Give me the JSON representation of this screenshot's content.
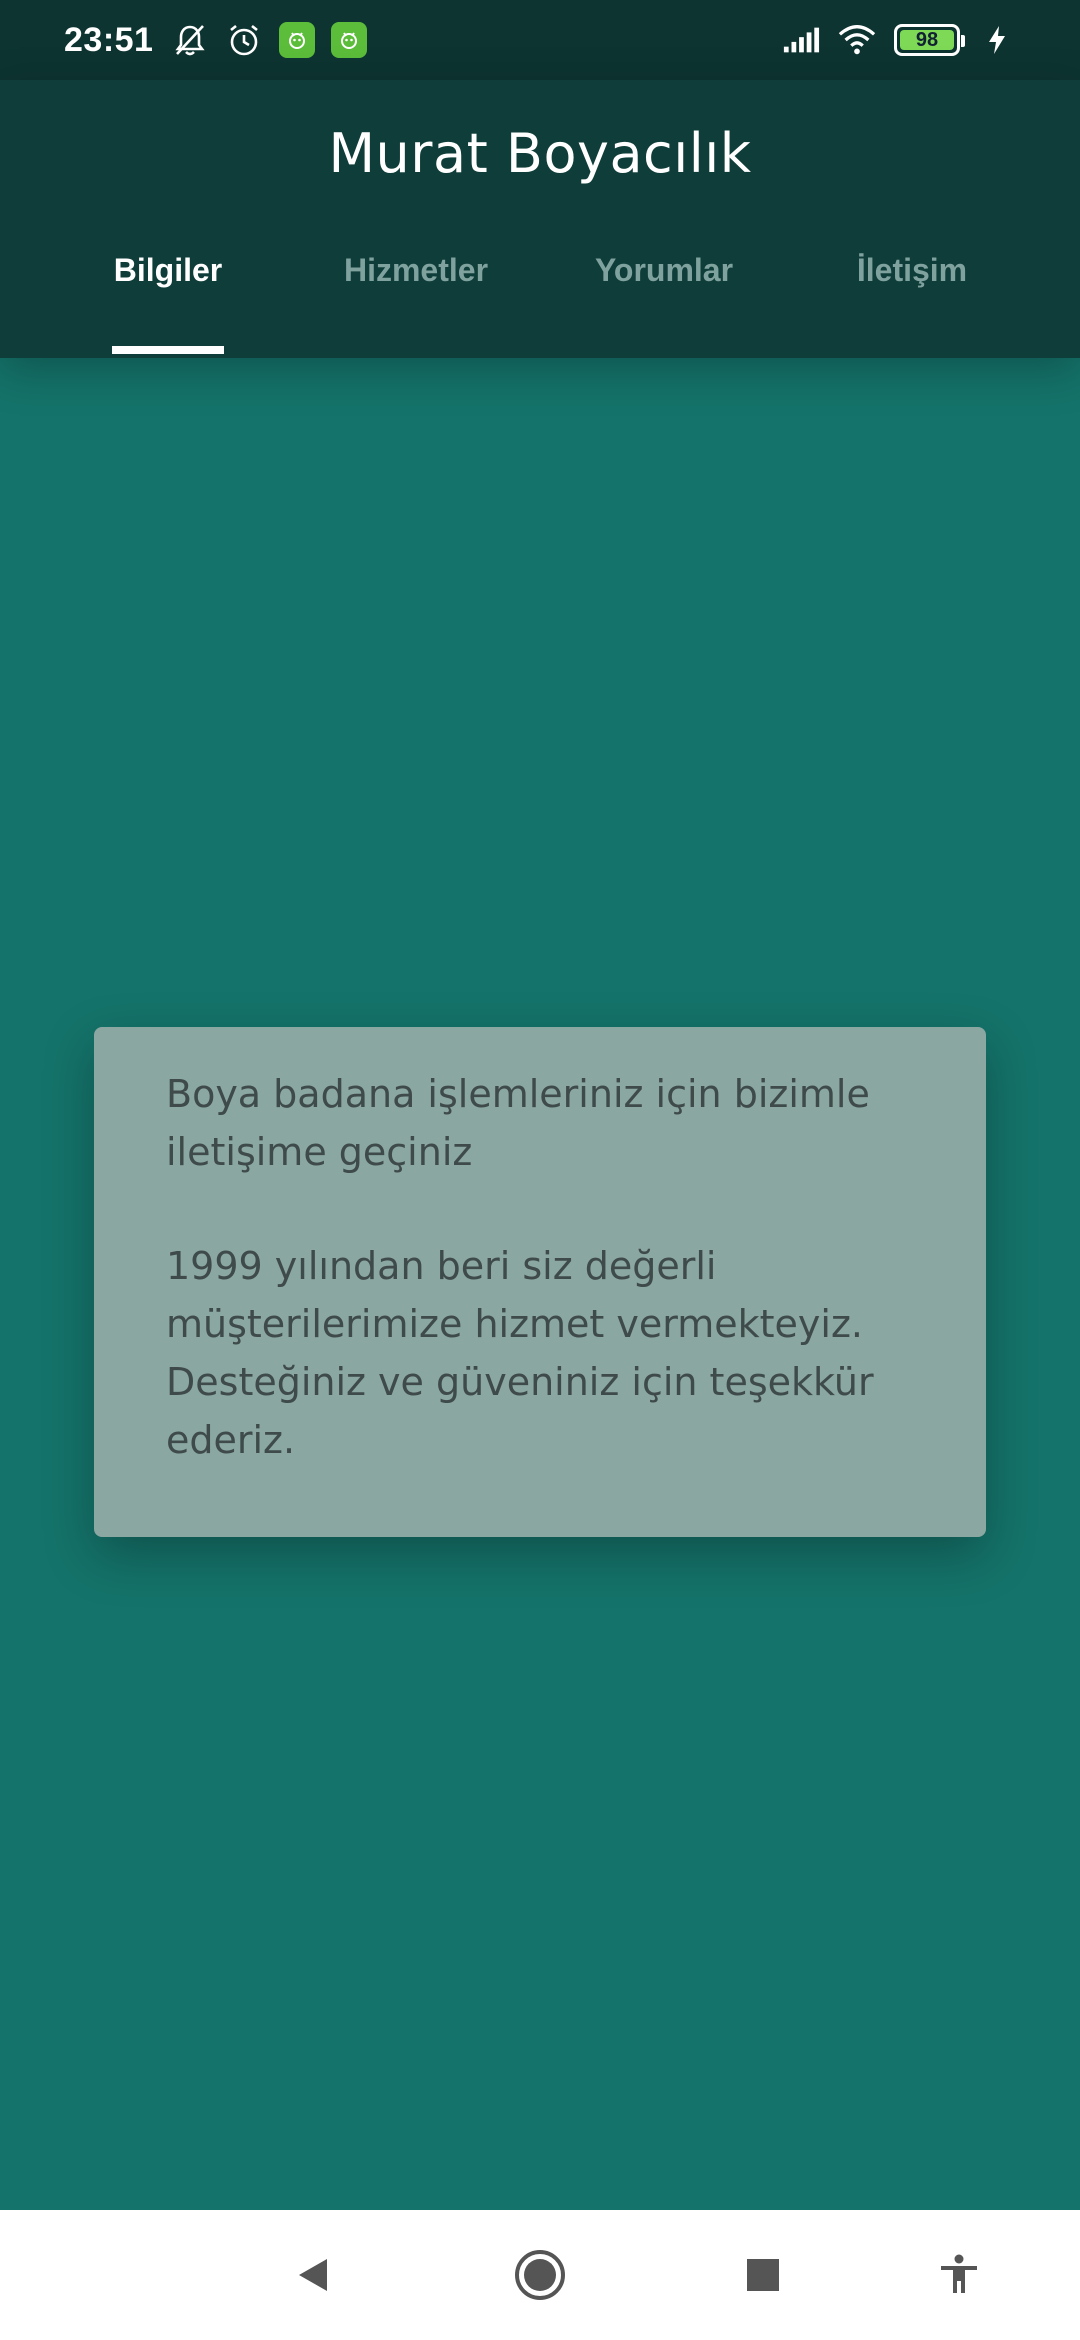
{
  "status_bar": {
    "time": "23:51",
    "left_icons": [
      "muted-bell-icon",
      "alarm-clock-icon",
      "app-notification-icon",
      "app-notification-icon"
    ],
    "right_icons": [
      "signal-icon",
      "wifi-icon",
      "battery-icon",
      "charging-bolt-icon"
    ],
    "battery_level": "98",
    "battery_color": "#7ed957"
  },
  "app_bar": {
    "title": "Murat Boyacılık",
    "tabs": [
      {
        "label": "Bilgiler",
        "active": true
      },
      {
        "label": "Hizmetler",
        "active": false
      },
      {
        "label": "Yorumlar",
        "active": false
      },
      {
        "label": "İletişim",
        "active": false
      }
    ]
  },
  "card": {
    "paragraph_1": "Boya badana işlemleriniz için bizimle iletişime geçiniz",
    "paragraph_2": "1999 yılından beri siz değerli müşterilerimize hizmet vermekteyiz. Desteğiniz ve güveniniz için teşekkür ederiz."
  },
  "colors": {
    "background": "#14736a",
    "app_bar": "#0f3d39",
    "status_bar": "#0d3431",
    "card": "#8aa7a1",
    "tab_inactive": "#7fa29f"
  },
  "nav_bar": {
    "buttons": [
      "back-icon",
      "home-icon",
      "recents-icon",
      "accessibility-icon"
    ]
  }
}
